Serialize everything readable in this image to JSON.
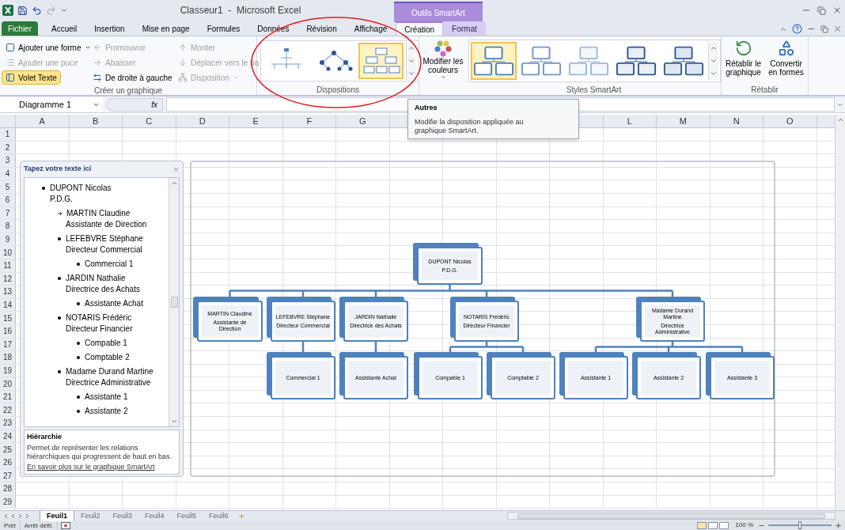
{
  "title_bar": {
    "title": "Classeur1  -  Microsoft Excel",
    "contextual_header": "Outils SmartArt"
  },
  "tabs": [
    {
      "label": "Fichier",
      "kind": "file",
      "contextual": false,
      "selected": false
    },
    {
      "label": "Accueil",
      "kind": "tab",
      "contextual": false,
      "selected": false
    },
    {
      "label": "Insertion",
      "kind": "tab",
      "contextual": false,
      "selected": false
    },
    {
      "label": "Mise en page",
      "kind": "tab",
      "contextual": false,
      "selected": false
    },
    {
      "label": "Formules",
      "kind": "tab",
      "contextual": false,
      "selected": false
    },
    {
      "label": "Données",
      "kind": "tab",
      "contextual": false,
      "selected": false
    },
    {
      "label": "Révision",
      "kind": "tab",
      "contextual": false,
      "selected": false
    },
    {
      "label": "Affichage",
      "kind": "tab",
      "contextual": false,
      "selected": false
    },
    {
      "label": "Création",
      "kind": "tab",
      "contextual": true,
      "selected": true
    },
    {
      "label": "Format",
      "kind": "tab",
      "contextual": true,
      "selected": false
    }
  ],
  "ribbon": {
    "create_group": {
      "label": "Créer un graphique",
      "commands": [
        {
          "label": "Ajouter une forme",
          "kind": "shape",
          "dropdown": true,
          "disabled": false,
          "on": false
        },
        {
          "label": "Ajouter une puce",
          "kind": "bullet",
          "dropdown": false,
          "disabled": true,
          "on": false
        },
        {
          "label": "Volet Texte",
          "kind": "pane",
          "dropdown": false,
          "disabled": false,
          "on": true
        },
        {
          "label": "Promouvoir",
          "kind": "promote",
          "dropdown": false,
          "disabled": true,
          "on": false
        },
        {
          "label": "Abaisser",
          "kind": "demote",
          "dropdown": false,
          "disabled": true,
          "on": false
        },
        {
          "label": "De droite à gauche",
          "kind": "rtl",
          "dropdown": false,
          "disabled": false,
          "on": false
        },
        {
          "label": "Monter",
          "kind": "up",
          "dropdown": false,
          "disabled": true,
          "on": false
        },
        {
          "label": "Déplacer vers le ba",
          "kind": "down",
          "dropdown": false,
          "disabled": true,
          "on": false
        },
        {
          "label": "Disposition",
          "kind": "layout",
          "dropdown": true,
          "disabled": true,
          "on": false
        }
      ]
    },
    "layouts_group": {
      "label": "Dispositions",
      "items": [
        {
          "kind": "radial",
          "selected": false
        },
        {
          "kind": "dots",
          "selected": false
        },
        {
          "kind": "org",
          "selected": true
        }
      ]
    },
    "colors_button": {
      "label": "Modifier les couleurs"
    },
    "styles_group": {
      "label": "Styles SmartArt",
      "items": [
        {
          "kind": "flat",
          "selected": true
        },
        {
          "kind": "subtle",
          "selected": false
        },
        {
          "kind": "light",
          "selected": false
        },
        {
          "kind": "moderate",
          "selected": false
        },
        {
          "kind": "intense",
          "selected": false
        }
      ]
    },
    "reset_group": {
      "label": "Rétablir",
      "buttons": [
        {
          "label": "Rétablir le graphique",
          "kind": "reset"
        },
        {
          "label": "Convertir en formes",
          "kind": "convert"
        }
      ]
    }
  },
  "formula_bar": {
    "name_box": "Diagramme 1",
    "function_symbol": "fx"
  },
  "tooltip": {
    "title": "Autres",
    "text": "Modifie la disposition appliquée au graphique SmartArt."
  },
  "sheet": {
    "columns_left": [
      "A",
      "B",
      "C",
      "D",
      "E",
      "F",
      "G"
    ],
    "columns_right": [
      "L",
      "M",
      "N",
      "O"
    ],
    "rows": [
      "1",
      "2",
      "3",
      "4",
      "5",
      "6",
      "7",
      "8",
      "9",
      "10",
      "11",
      "12",
      "13",
      "14",
      "15",
      "16",
      "17",
      "18",
      "19",
      "20",
      "21",
      "22",
      "23",
      "24",
      "25",
      "26",
      "27",
      "28",
      "29"
    ]
  },
  "text_pane": {
    "title": "Tapez votre texte ici",
    "items": [
      {
        "kind": "bullet",
        "lines": [
          "DUPONT Nicolas",
          "P.D.G."
        ],
        "children": [
          {
            "kind": "assistant",
            "lines": [
              "MARTIN Claudine",
              "Assistante de Direction"
            ]
          },
          {
            "kind": "bullet",
            "lines": [
              "LEFEBVRE Stéphane",
              "Directeur Commercial"
            ],
            "children": [
              {
                "kind": "bullet",
                "lines": [
                  "Commercial 1"
                ]
              }
            ]
          },
          {
            "kind": "bullet",
            "lines": [
              "JARDIN Nathalie",
              "Directrice des Achats"
            ],
            "children": [
              {
                "kind": "bullet",
                "lines": [
                  "Assistante Achat"
                ]
              }
            ]
          },
          {
            "kind": "bullet",
            "lines": [
              "NOTARIS Frédéric",
              "Directeur Financier"
            ],
            "children": [
              {
                "kind": "bullet",
                "lines": [
                  "Compable 1"
                ]
              },
              {
                "kind": "bullet",
                "lines": [
                  "Comptable 2"
                ]
              }
            ]
          },
          {
            "kind": "bullet",
            "lines": [
              "Madame Durand Martine",
              "Directrice Administrative"
            ],
            "children": [
              {
                "kind": "bullet",
                "lines": [
                  "Assistante 1"
                ]
              },
              {
                "kind": "bullet",
                "lines": [
                  "Assistante 2"
                ]
              }
            ]
          }
        ]
      }
    ],
    "info_title": "Hiérarchie",
    "info_text": "Permet de représenter les relations hiérarchiques qui progressent de haut en bas.",
    "link": "En savoir plus sur le graphique SmartArt"
  },
  "org_chart": {
    "root": {
      "lines": [
        "DUPONT Nicolas",
        "P.D.G."
      ],
      "children": [
        {
          "lines": [
            "MARTIN Claudine",
            "Assistante de Direction"
          ]
        },
        {
          "lines": [
            "LEFEBVRE Stéphane",
            "Directeur Commercial"
          ],
          "children": [
            {
              "lines": [
                "Commercial 1"
              ]
            }
          ]
        },
        {
          "lines": [
            "JARDIN Nathalie",
            "Directrice des Achats"
          ],
          "children": [
            {
              "lines": [
                "Assistante Achat"
              ]
            }
          ]
        },
        {
          "lines": [
            "NOTARIS Frédéric",
            "Directeur Financier"
          ],
          "children": [
            {
              "lines": [
                "Compable 1"
              ]
            },
            {
              "lines": [
                "Comptable 2"
              ]
            }
          ]
        },
        {
          "lines": [
            "Madame Durand Martine",
            "Directrice Administrative"
          ],
          "children": [
            {
              "lines": [
                "Assistante 1"
              ]
            },
            {
              "lines": [
                "Assistante 2"
              ]
            },
            {
              "lines": [
                "Assistante 3"
              ]
            }
          ]
        }
      ]
    }
  },
  "sheet_tabs": [
    {
      "label": "Feuil1",
      "selected": true
    },
    {
      "label": "Feuil2",
      "selected": false
    },
    {
      "label": "Feuil3",
      "selected": false
    },
    {
      "label": "Feuil4",
      "selected": false
    },
    {
      "label": "Feuil5",
      "selected": false
    },
    {
      "label": "Feuil6",
      "selected": false
    }
  ],
  "status_bar": {
    "items": [
      "Prêt",
      "Arrêt défil."
    ],
    "zoom": "100 %",
    "zoom_slider": {
      "level": 0.5
    }
  }
}
